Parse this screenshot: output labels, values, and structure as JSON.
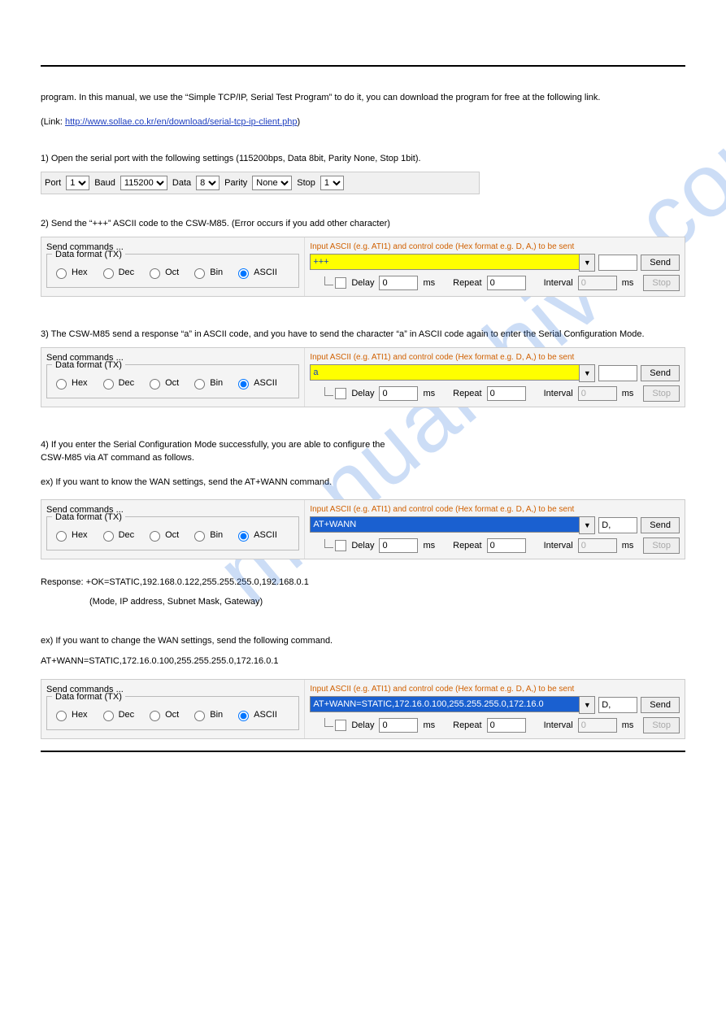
{
  "link_text": "http://www.sollae.co.kr/en/download/serial-tcp-ip-client.php",
  "text": {
    "intro_cont": "program. In this manual, we use the “Simple TCP/IP, Serial Test Program” to do it, you can download the program for free at the following link.",
    "p1": "1) Open the serial port with the following settings (115200bps, Data 8bit, Parity None, Stop 1bit).",
    "p2": "2) Send the “+++” ASCII code to the CSW-M85. (Error occurs if you add other character)",
    "p3": "3) The CSW-M85 send a response “a” in ASCII code, and you have to send the character “a” in ASCII code again to enter the Serial Configuration Mode.",
    "p4_a": "4) If you enter the Serial Configuration Mode successfully, you are able to configure the",
    "p4_b": "CSW-M85 via AT command as follows.",
    "ex1": "ex) If you want to know the WAN settings, send the AT+WANN command.",
    "resp1": "Response: +OK=STATIC,192.168.0.122,255.255.255.0,192.168.0.1",
    "resp2": "(Mode, IP address, Subnet Mask, Gateway)",
    "ex2": "ex) If you want to change the WAN settings, send the following command.",
    "ex2_cmd": "AT+WANN=STATIC,172.16.0.100,255.255.255.0,172.16.0.1"
  },
  "serialbar": {
    "port_label": "Port",
    "port": "1",
    "baud_label": "Baud",
    "baud": "115200",
    "data_label": "Data",
    "data": "8",
    "parity_label": "Parity",
    "parity": "None",
    "stop_label": "Stop",
    "stop": "1"
  },
  "labels": {
    "send_commands": "Send commands ...",
    "data_format": "Data format (TX)",
    "hex": "Hex",
    "dec": "Dec",
    "oct": "Oct",
    "bin": "Bin",
    "ascii": "ASCII",
    "hint": "Input ASCII (e.g. ATI1) and control code (Hex format  e.g. D, A,) to be sent",
    "send": "Send",
    "stop": "Stop",
    "delay": "Delay",
    "repeat": "Repeat",
    "interval": "Interval",
    "ms": "ms",
    "zero": "0"
  },
  "panels": [
    {
      "cmd": "+++",
      "suffix": "",
      "selected": false
    },
    {
      "cmd": "a",
      "suffix": "",
      "selected": false
    },
    {
      "cmd": "AT+WANN",
      "suffix": "D,",
      "selected": true
    },
    {
      "cmd": "AT+WANN=STATIC,172.16.0.100,255.255.255.0,172.16.0",
      "suffix": "D,",
      "selected": true
    }
  ]
}
